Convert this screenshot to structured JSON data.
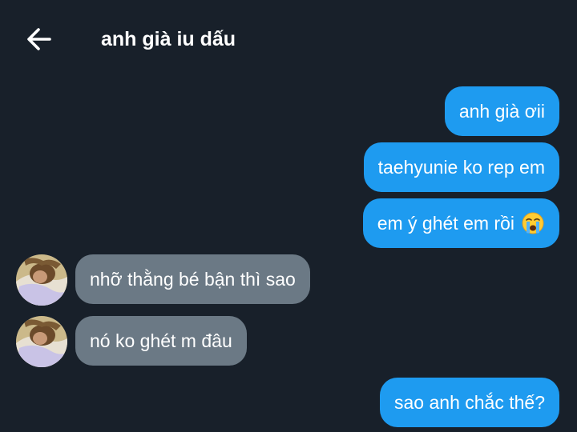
{
  "header": {
    "back_icon": "arrow-left-icon",
    "title": "anh già iu dấu"
  },
  "colors": {
    "background": "#18202a",
    "outgoing_bubble": "#1e9bf0",
    "incoming_bubble": "#6b7985",
    "text": "#ffffff"
  },
  "messages": [
    {
      "direction": "outgoing",
      "text": "anh già ơii"
    },
    {
      "direction": "outgoing",
      "text": "taehyunie ko rep em"
    },
    {
      "direction": "outgoing",
      "text": "em ý ghét em rồi",
      "emoji": "loudly-crying-face-icon"
    },
    {
      "direction": "incoming",
      "text": "nhỡ thằng bé bận thì sao",
      "avatar": "avatar"
    },
    {
      "direction": "incoming",
      "text": "nó ko ghét m đâu",
      "avatar": "avatar"
    },
    {
      "direction": "outgoing",
      "text": "sao anh chắc thế?"
    }
  ]
}
